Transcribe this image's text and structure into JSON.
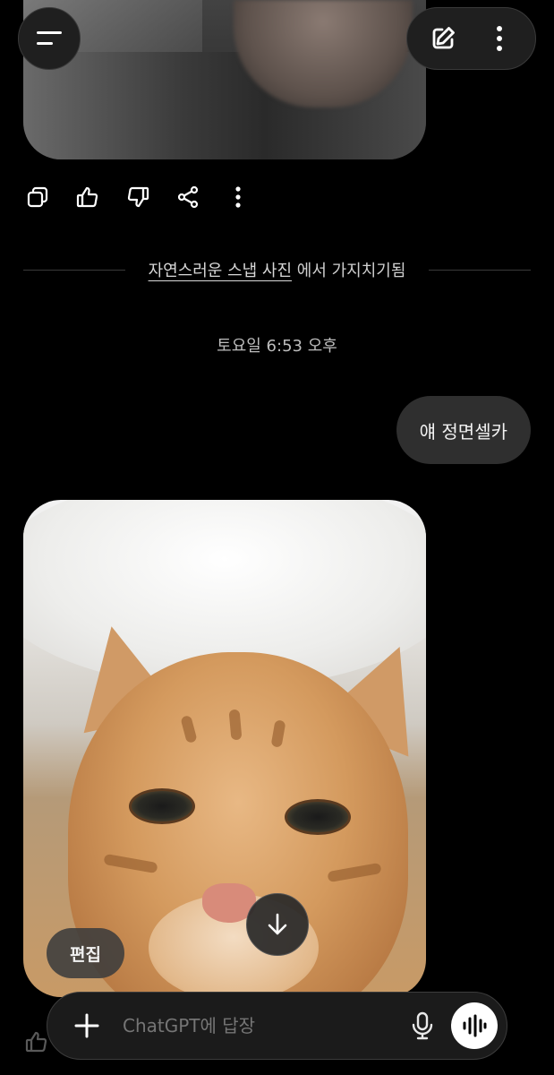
{
  "header": {
    "menu_icon": "menu-icon",
    "new_chat_icon": "edit-icon",
    "more_icon": "more-vertical-icon"
  },
  "message_actions": {
    "icons": [
      "copy-icon",
      "thumbs-up-icon",
      "thumbs-down-icon",
      "share-icon",
      "more-vertical-icon"
    ]
  },
  "branch": {
    "link_text": "자연스러운 스냅 사진",
    "suffix": "에서 가지치기됨"
  },
  "timestamp": "토요일 6:53 오후",
  "user_message": "얘 정면셀카",
  "image_overlay": {
    "edit_label": "편집",
    "scroll_icon": "arrow-down-icon"
  },
  "composer": {
    "placeholder": "ChatGPT에 답장",
    "add_icon": "plus-icon",
    "mic_icon": "mic-icon",
    "voice_icon": "voice-mode-icon"
  }
}
